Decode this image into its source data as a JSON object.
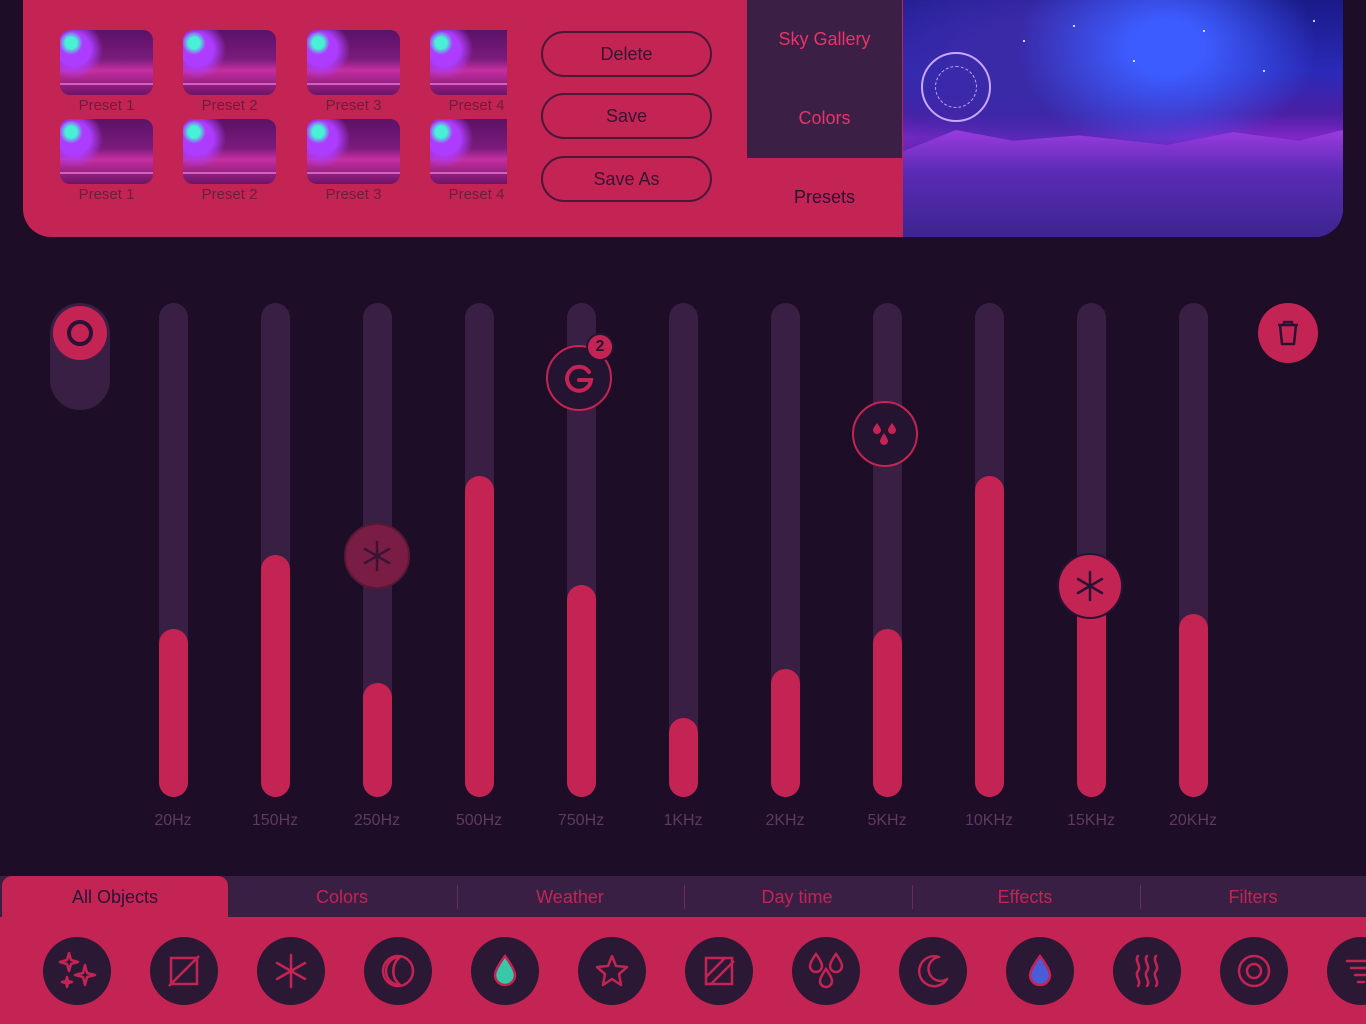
{
  "presets": {
    "items": [
      {
        "label": "Preset 1"
      },
      {
        "label": "Preset 2"
      },
      {
        "label": "Preset 3"
      },
      {
        "label": "Preset 4"
      },
      {
        "label": "Preset 1"
      },
      {
        "label": "Preset 2"
      },
      {
        "label": "Preset 3"
      },
      {
        "label": "Preset 4"
      }
    ]
  },
  "actions": {
    "delete": "Delete",
    "save": "Save",
    "save_as": "Save As"
  },
  "side_tabs": {
    "sky_gallery": "Sky Gallery",
    "colors": "Colors",
    "presets": "Presets",
    "active": "presets"
  },
  "equalizer": {
    "bands": [
      {
        "label": "20Hz",
        "level": 0.34
      },
      {
        "label": "150Hz",
        "level": 0.49
      },
      {
        "label": "250Hz",
        "level": 0.23
      },
      {
        "label": "500Hz",
        "level": 0.65
      },
      {
        "label": "750Hz",
        "level": 0.43
      },
      {
        "label": "1KHz",
        "level": 0.16
      },
      {
        "label": "2KHz",
        "level": 0.26
      },
      {
        "label": "5KHz",
        "level": 0.34
      },
      {
        "label": "10KHz",
        "level": 0.65
      },
      {
        "label": "15KHz",
        "level": 0.42
      },
      {
        "label": "20KHz",
        "level": 0.37
      }
    ],
    "markers": [
      {
        "band": "250Hz",
        "icon": "snowflake-icon",
        "style": "faded"
      },
      {
        "band": "750Hz",
        "icon": "g-icon",
        "style": "outline",
        "badge": "2"
      },
      {
        "band": "5KHz",
        "icon": "drops-icon",
        "style": "outline"
      },
      {
        "band": "15KHz",
        "icon": "snowflake-icon",
        "style": "filled"
      }
    ]
  },
  "bottom_tabs": {
    "items": [
      {
        "label": "All Objects"
      },
      {
        "label": "Colors"
      },
      {
        "label": "Weather"
      },
      {
        "label": "Day time"
      },
      {
        "label": "Effects"
      },
      {
        "label": "Filters"
      }
    ],
    "active": "All Objects"
  },
  "objects": [
    "sparkles-icon",
    "no-image-icon",
    "snowflake-icon",
    "moon-phase-icon",
    "teal-drop-icon",
    "star-icon",
    "square-slash-icon",
    "rain-drops-icon",
    "crescent-moon-icon",
    "blue-drop-icon",
    "heat-waves-icon",
    "target-icon",
    "tornado-icon"
  ],
  "colors": {
    "accent": "#c32454",
    "background": "#1e0d26",
    "track": "#3a1f44",
    "icon_bg": "#2b1834"
  }
}
